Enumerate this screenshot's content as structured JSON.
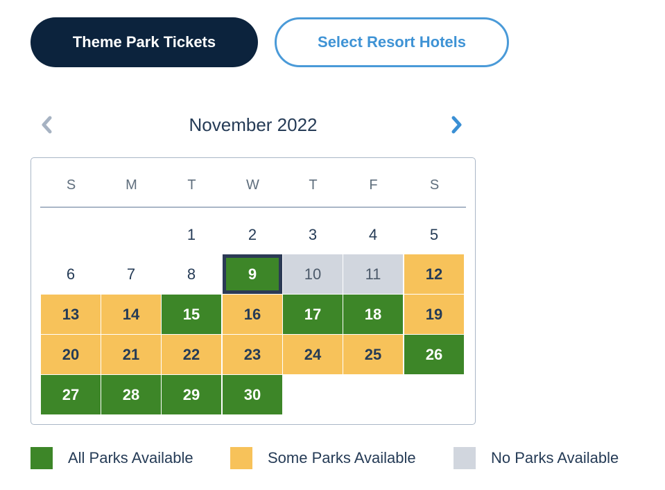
{
  "tabs": {
    "primary_label": "Theme Park Tickets",
    "secondary_label": "Select Resort Hotels"
  },
  "calendar": {
    "month_title": "November 2022",
    "prev_icon": "chevron-left-icon",
    "next_icon": "chevron-right-icon",
    "weekdays": [
      "S",
      "M",
      "T",
      "W",
      "T",
      "F",
      "S"
    ],
    "first_weekday_index": 2,
    "selected_day": 9,
    "days": [
      {
        "day": "1",
        "status": "plain"
      },
      {
        "day": "2",
        "status": "plain"
      },
      {
        "day": "3",
        "status": "plain"
      },
      {
        "day": "4",
        "status": "plain"
      },
      {
        "day": "5",
        "status": "plain"
      },
      {
        "day": "6",
        "status": "plain"
      },
      {
        "day": "7",
        "status": "plain"
      },
      {
        "day": "8",
        "status": "plain"
      },
      {
        "day": "9",
        "status": "all"
      },
      {
        "day": "10",
        "status": "none"
      },
      {
        "day": "11",
        "status": "none"
      },
      {
        "day": "12",
        "status": "some"
      },
      {
        "day": "13",
        "status": "some"
      },
      {
        "day": "14",
        "status": "some"
      },
      {
        "day": "15",
        "status": "all"
      },
      {
        "day": "16",
        "status": "some"
      },
      {
        "day": "17",
        "status": "all"
      },
      {
        "day": "18",
        "status": "all"
      },
      {
        "day": "19",
        "status": "some"
      },
      {
        "day": "20",
        "status": "some"
      },
      {
        "day": "21",
        "status": "some"
      },
      {
        "day": "22",
        "status": "some"
      },
      {
        "day": "23",
        "status": "some"
      },
      {
        "day": "24",
        "status": "some"
      },
      {
        "day": "25",
        "status": "some"
      },
      {
        "day": "26",
        "status": "all"
      },
      {
        "day": "27",
        "status": "all"
      },
      {
        "day": "28",
        "status": "all"
      },
      {
        "day": "29",
        "status": "all"
      },
      {
        "day": "30",
        "status": "all"
      }
    ]
  },
  "legend": [
    {
      "label": "All Parks Available",
      "status": "all",
      "color": "#3d8628"
    },
    {
      "label": "Some Parks Available",
      "status": "some",
      "color": "#f7c25a"
    },
    {
      "label": "No Parks Available",
      "status": "none",
      "color": "#d1d6de"
    }
  ],
  "colors": {
    "primary_button": "#0c233d",
    "accent_blue": "#3f93d5",
    "all_parks": "#3d8628",
    "some_parks": "#f7c25a",
    "no_parks": "#d1d6de",
    "selected_border": "#2b3a55"
  }
}
